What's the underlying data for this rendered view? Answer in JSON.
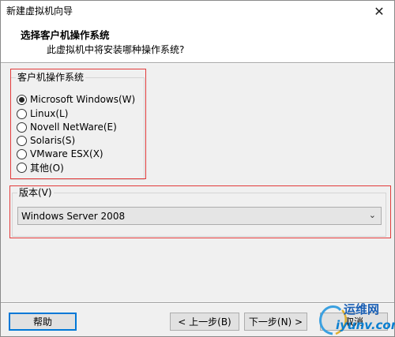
{
  "window": {
    "title": "新建虚拟机向导",
    "close_symbol": "✕"
  },
  "header": {
    "title": "选择客户机操作系统",
    "subtitle": "此虚拟机中将安装哪种操作系统?"
  },
  "os_group": {
    "legend": "客户机操作系统",
    "options": [
      {
        "label": "Microsoft Windows(W)",
        "checked": true
      },
      {
        "label": "Linux(L)",
        "checked": false
      },
      {
        "label": "Novell NetWare(E)",
        "checked": false
      },
      {
        "label": "Solaris(S)",
        "checked": false
      },
      {
        "label": "VMware ESX(X)",
        "checked": false
      },
      {
        "label": "其他(O)",
        "checked": false
      }
    ]
  },
  "version_group": {
    "legend": "版本(V)",
    "selected": "Windows Server 2008",
    "arrow": "⌄"
  },
  "footer": {
    "help_label": "帮助",
    "back_label": "< 上一步(B)",
    "next_label": "下一步(N) >",
    "cancel_label": "取消"
  },
  "watermark": {
    "line1": "运维网",
    "line2": "iyunv.com"
  },
  "colors": {
    "highlight_border": "#e23b3b",
    "focus_border": "#0078d7"
  },
  "icons": {
    "close": "close-icon",
    "dropdown": "chevron-down-icon"
  }
}
